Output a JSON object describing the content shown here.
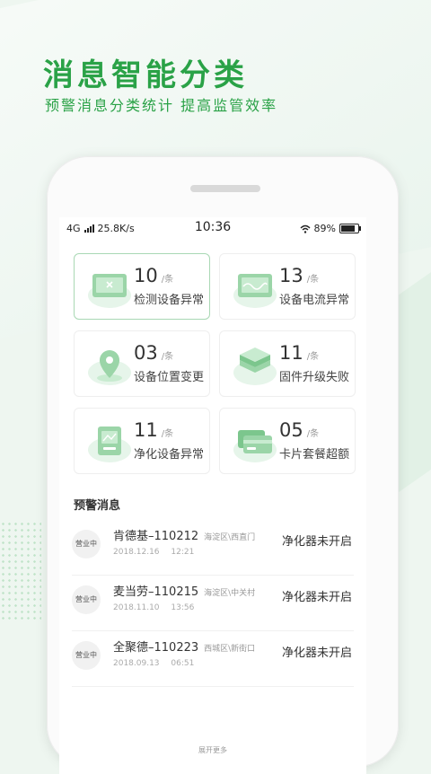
{
  "hero": {
    "title": "消息智能分类",
    "subtitle": "预警消息分类统计  提高监管效率"
  },
  "status_bar": {
    "network": "4G",
    "speed": "25.8K/s",
    "time": "10:36",
    "battery": "89%"
  },
  "categories": [
    {
      "count": "10",
      "unit": "/条",
      "label": "检测设备异常",
      "icon": "monitor-x-icon"
    },
    {
      "count": "13",
      "unit": "/条",
      "label": "设备电流异常",
      "icon": "monitor-wave-icon"
    },
    {
      "count": "03",
      "unit": "/条",
      "label": "设备位置变更",
      "icon": "location-pin-icon"
    },
    {
      "count": "11",
      "unit": "/条",
      "label": "固件升级失败",
      "icon": "layers-icon"
    },
    {
      "count": "11",
      "unit": "/条",
      "label": "净化设备异常",
      "icon": "purifier-icon"
    },
    {
      "count": "05",
      "unit": "/条",
      "label": "卡片套餐超额",
      "icon": "cards-icon"
    }
  ],
  "alerts": {
    "title": "预警消息",
    "items": [
      {
        "badge": "营业中",
        "name": "肯德基–110212",
        "area": "海淀区\\西直门",
        "date": "2018.12.16",
        "time": "12:21",
        "status": "净化器未开启"
      },
      {
        "badge": "营业中",
        "name": "麦当劳–110215",
        "area": "海淀区\\中关村",
        "date": "2018.11.10",
        "time": "13:56",
        "status": "净化器未开启"
      },
      {
        "badge": "营业中",
        "name": "全聚德–110223",
        "area": "西城区\\新街口",
        "date": "2018.09.13",
        "time": "06:51",
        "status": "净化器未开启"
      }
    ],
    "more_label": "展开更多"
  },
  "colors": {
    "brand": "#2aa247",
    "icon_green": "#9bd5a8"
  }
}
